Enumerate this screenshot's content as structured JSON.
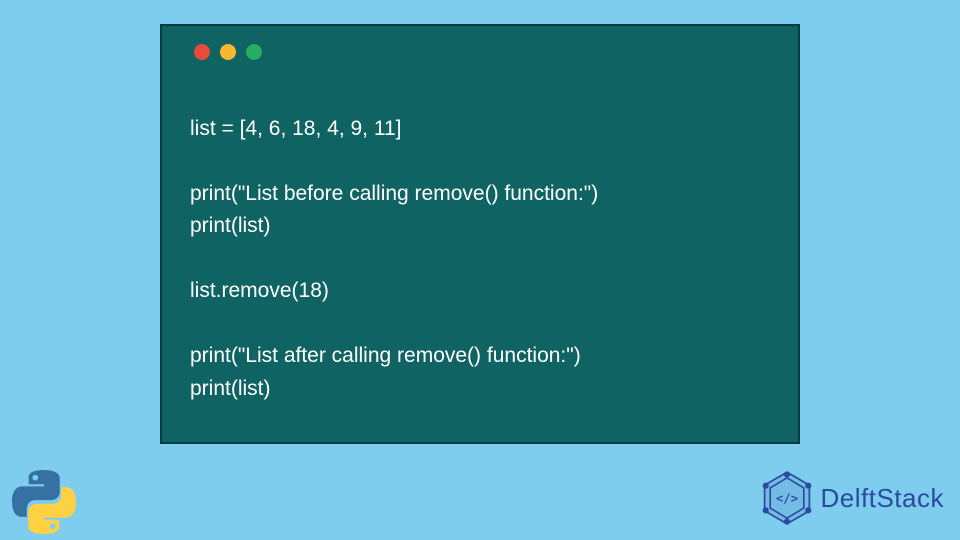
{
  "window": {
    "traffic_lights": [
      "red",
      "yellow",
      "green"
    ]
  },
  "code": {
    "lines": [
      "list = [4, 6, 18, 4, 9, 11]",
      "",
      "print(\"List before calling remove() function:\")",
      "print(list)",
      "",
      "list.remove(18)",
      "",
      "print(\"List after calling remove() function:\")",
      "print(list)"
    ]
  },
  "brand": {
    "name": "DelftStack"
  },
  "icons": {
    "python": "python-logo",
    "delft": "delft-logo"
  },
  "colors": {
    "bg": "#7ecdee",
    "window": "#0f6362",
    "brand": "#2b4aa0"
  }
}
